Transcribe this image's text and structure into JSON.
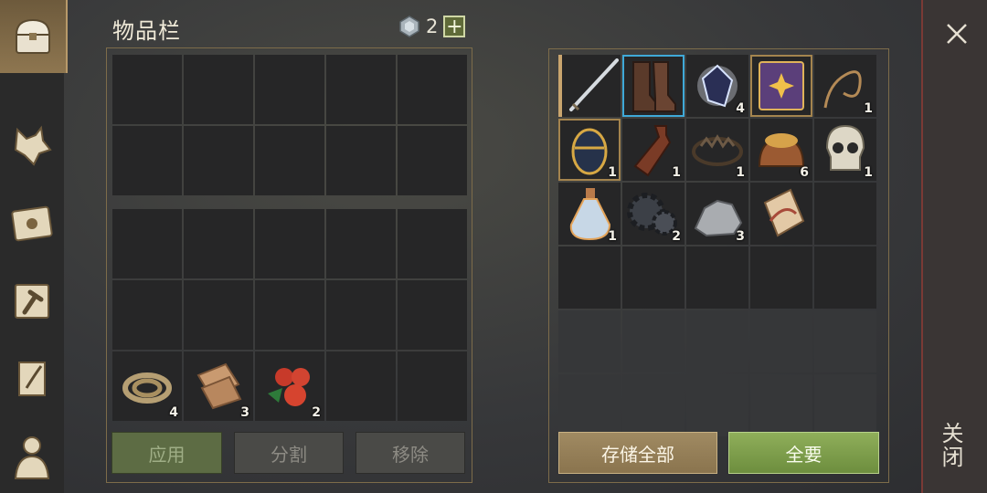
{
  "header": {
    "title": "物品栏",
    "currency_value": "2",
    "plus_label": "+"
  },
  "sidebar": {
    "items": [
      {
        "icon": "chest-icon",
        "active": true
      },
      {
        "icon": "wolf-head-icon",
        "active": false
      },
      {
        "icon": "sun-book-icon",
        "active": false
      },
      {
        "icon": "hammer-icon",
        "active": false
      },
      {
        "icon": "scroll-quill-icon",
        "active": false
      },
      {
        "icon": "character-icon",
        "active": false
      }
    ]
  },
  "inventory": {
    "bottom_row_items": [
      {
        "name": "rope",
        "qty": "4"
      },
      {
        "name": "cloth",
        "qty": "3"
      },
      {
        "name": "berries",
        "qty": "2"
      }
    ],
    "buttons": {
      "apply": "应用",
      "split": "分割",
      "remove": "移除"
    }
  },
  "storage": {
    "items": [
      {
        "name": "sword",
        "qty": ""
      },
      {
        "name": "boots",
        "qty": ""
      },
      {
        "name": "crystal",
        "qty": "4"
      },
      {
        "name": "spellbook",
        "qty": ""
      },
      {
        "name": "whip",
        "qty": "1"
      },
      {
        "name": "egg",
        "qty": "1"
      },
      {
        "name": "leather-bottle",
        "qty": "1"
      },
      {
        "name": "bear-trap",
        "qty": "1"
      },
      {
        "name": "grain-sack",
        "qty": "6"
      },
      {
        "name": "skull",
        "qty": "1"
      },
      {
        "name": "potion",
        "qty": "1"
      },
      {
        "name": "gear",
        "qty": "2"
      },
      {
        "name": "stone",
        "qty": "3"
      },
      {
        "name": "bandage",
        "qty": ""
      }
    ],
    "buttons": {
      "store_all": "存储全部",
      "take_all": "全要"
    }
  },
  "close": {
    "label": "关闭"
  }
}
